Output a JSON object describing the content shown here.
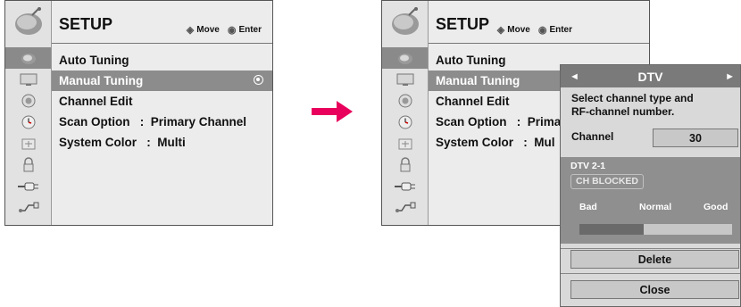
{
  "left_menu": {
    "title": "SETUP",
    "move_hint": "Move",
    "enter_hint": "Enter",
    "items": [
      {
        "label": "Auto Tuning"
      },
      {
        "label": "Manual Tuning"
      },
      {
        "label": "Channel Edit"
      },
      {
        "label": "Scan Option   :  Primary Channel"
      },
      {
        "label": "System Color   :  Multi"
      }
    ],
    "selected_index": 1
  },
  "right_menu": {
    "title": "SETUP",
    "move_hint": "Move",
    "enter_hint": "Enter",
    "items": [
      {
        "label": "Auto Tuning"
      },
      {
        "label": "Manual Tuning"
      },
      {
        "label": "Channel Edit"
      },
      {
        "label": "Scan Option   :  Prima"
      },
      {
        "label": "System Color   :  Mul"
      }
    ],
    "selected_index": 1
  },
  "side_icons": [
    "satellite-icon",
    "tv-screen-icon",
    "speaker-icon",
    "clock-icon",
    "lock-icon",
    "padlock-icon",
    "input-plug-icon",
    "usb-icon"
  ],
  "popup": {
    "header": "DTV",
    "prev_arrow": "◄",
    "next_arrow": "►",
    "description_line1": "Select channel type and",
    "description_line2": "RF-channel number.",
    "channel_label": "Channel",
    "channel_value": "30",
    "program": "DTV 2-1",
    "blocked_badge": "CH  BLOCKED",
    "signal_bad": "Bad",
    "signal_normal": "Normal",
    "signal_good": "Good",
    "signal_level": 0.42,
    "delete_label": "Delete",
    "close_label": "Close"
  },
  "colors": {
    "highlight": "#8c8c8c",
    "arrow": "#e8005c",
    "popup_header": "#7a7a7a"
  }
}
